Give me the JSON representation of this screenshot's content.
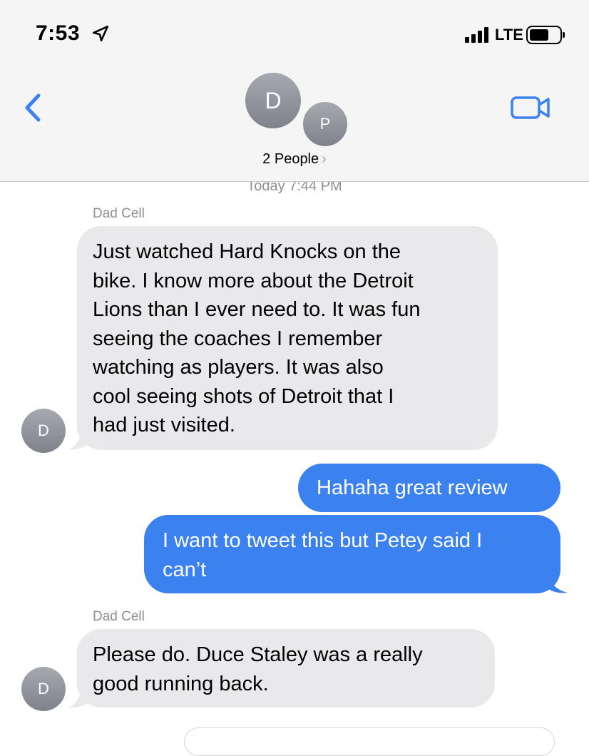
{
  "status_bar": {
    "time": "7:53",
    "carrier": "LTE"
  },
  "header": {
    "avatar_primary": "D",
    "avatar_secondary": "P",
    "title": "2 People",
    "chevron": "›"
  },
  "conversation": {
    "timestamp": "Today 7:44 PM",
    "messages": [
      {
        "direction": "incoming",
        "sender": "Dad Cell",
        "avatar": "D",
        "lines": [
          "Just watched Hard Knocks on the",
          "bike. I know more about the Detroit",
          "Lions than I ever need to. It was fun",
          "seeing the coaches I remember",
          "watching as players. It was also",
          "cool seeing shots of Detroit that I",
          "had just visited."
        ]
      },
      {
        "direction": "outgoing",
        "lines": [
          "Hahaha great review"
        ]
      },
      {
        "direction": "outgoing",
        "lines": [
          "I want to tweet this but Petey said I",
          "can’t"
        ]
      },
      {
        "direction": "incoming",
        "sender": "Dad Cell",
        "avatar": "D",
        "lines": [
          "Please do. Duce Staley was a really",
          "good running back."
        ]
      }
    ]
  },
  "colors": {
    "accent_blue": "#3b82f0",
    "incoming_bubble": "#e9e9eb",
    "header_bg": "#f5f5f5",
    "secondary_text": "#8e8e93"
  }
}
